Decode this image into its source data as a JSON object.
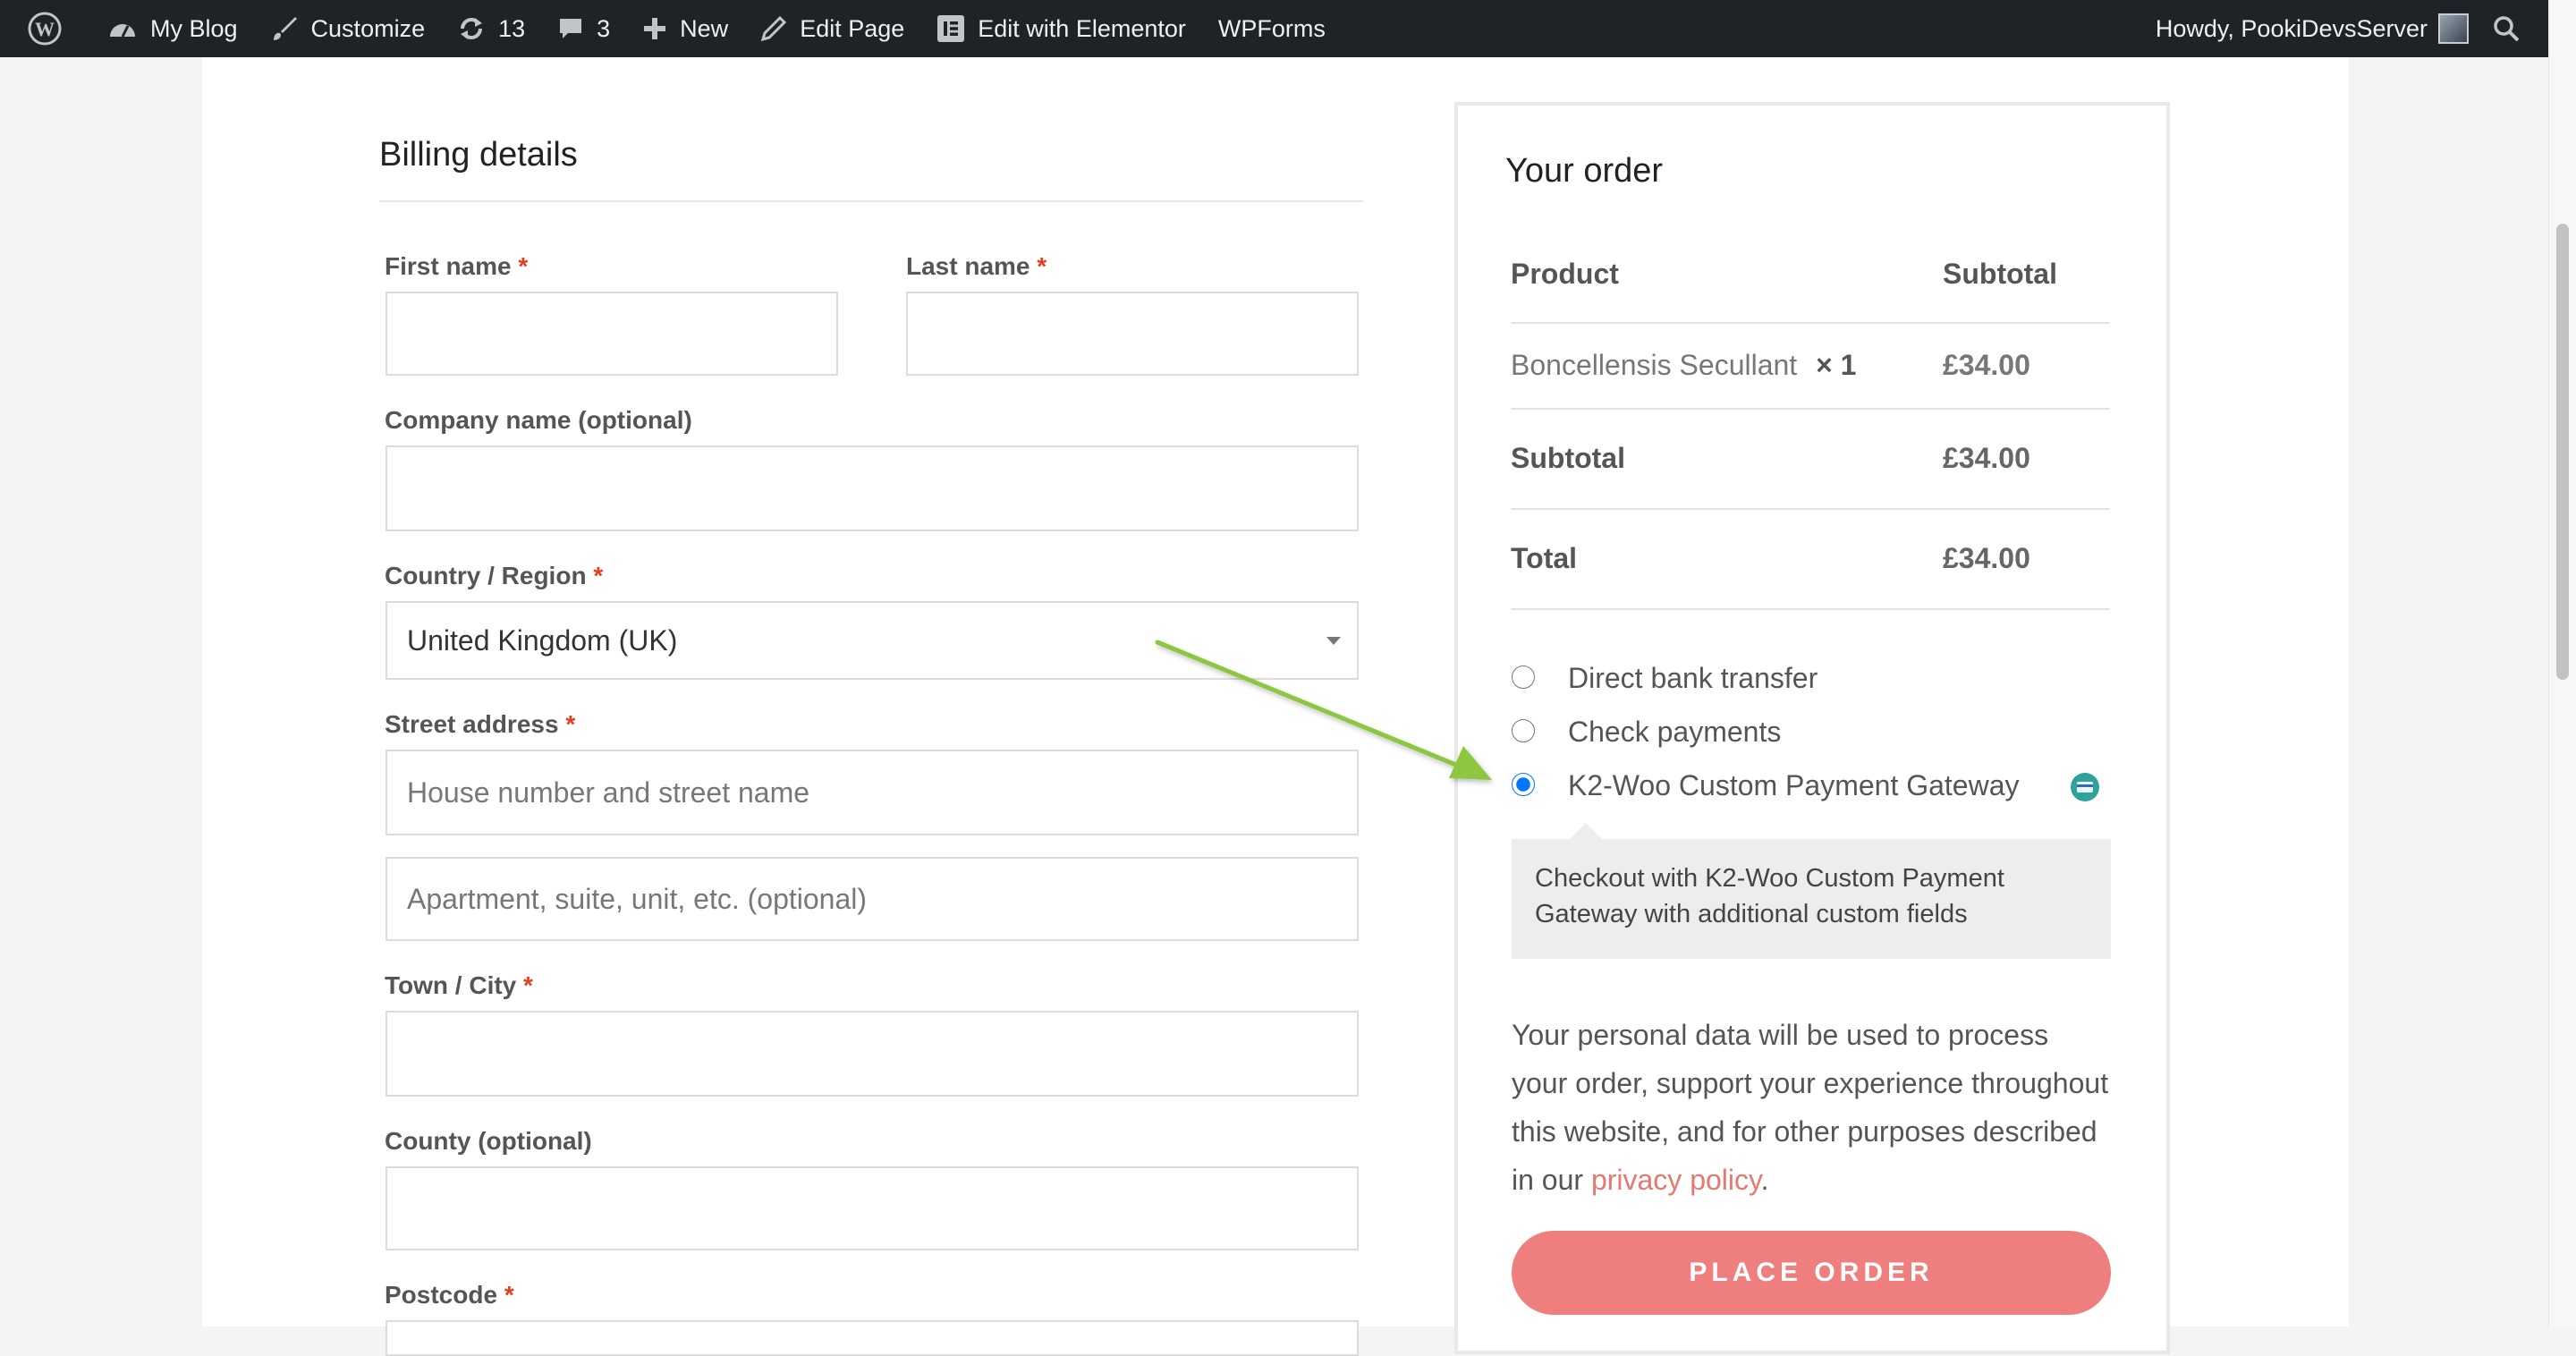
{
  "admin_bar": {
    "site_name": "My Blog",
    "customize": "Customize",
    "updates_count": "13",
    "comments_count": "3",
    "new_label": "New",
    "edit_page": "Edit Page",
    "edit_elementor": "Edit with Elementor",
    "wpforms": "WPForms",
    "howdy": "Howdy, PookiDevsServer"
  },
  "billing": {
    "title": "Billing details",
    "required_mark": "*",
    "first_name_label": "First name",
    "last_name_label": "Last name",
    "company_label": "Company name (optional)",
    "country_label": "Country / Region",
    "country_value": "United Kingdom (UK)",
    "street_label": "Street address",
    "street_placeholder_1": "House number and street name",
    "street_placeholder_2": "Apartment, suite, unit, etc. (optional)",
    "town_label": "Town / City",
    "county_label": "County (optional)",
    "postcode_label": "Postcode"
  },
  "order": {
    "title": "Your order",
    "col_product": "Product",
    "col_subtotal": "Subtotal",
    "item_name": "Boncellensis Secullant",
    "item_qty": "× 1",
    "item_price": "£34.00",
    "subtotal_label": "Subtotal",
    "subtotal_value": "£34.00",
    "total_label": "Total",
    "total_value": "£34.00",
    "payment_methods": [
      {
        "label": "Direct bank transfer",
        "selected": false
      },
      {
        "label": "Check payments",
        "selected": false
      },
      {
        "label": "K2-Woo Custom Payment Gateway",
        "selected": true
      }
    ],
    "payment_description": "Checkout with K2-Woo Custom Payment Gateway with additional custom fields",
    "privacy_text": "Your personal data will be used to process your order, support your experience throughout this website, and for other purposes described in our",
    "privacy_link": "privacy policy",
    "privacy_end": ".",
    "place_order": "PLACE ORDER"
  },
  "colors": {
    "admin_bar": "#1d2327",
    "accent_button": "#ef7e7e",
    "link": "#e8776f",
    "required": "#e2401c",
    "annotation_arrow": "#8dc63f"
  }
}
